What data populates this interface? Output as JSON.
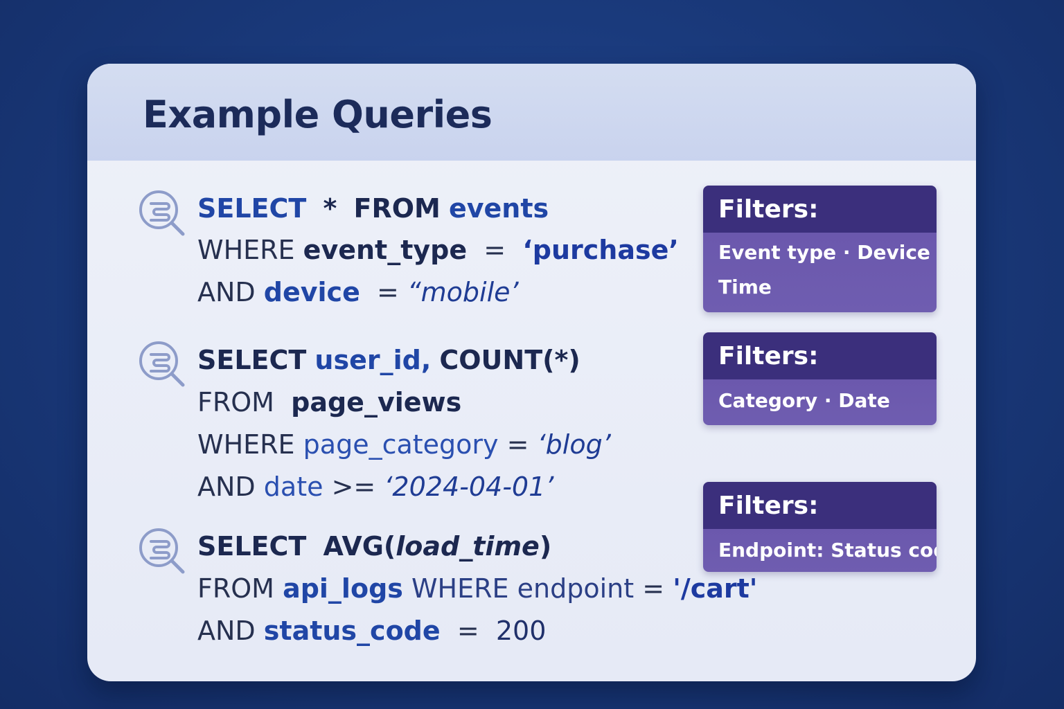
{
  "title": "Example Queries",
  "queries": [
    {
      "icon": "search-database-icon",
      "line1": {
        "a": "SELECT",
        "b": "*",
        "c": "FROM",
        "d": "events"
      },
      "line2": {
        "a": "WHERE",
        "b": "event_type",
        "c": "=",
        "d": "‘purchase’"
      },
      "line3": {
        "a": "AND",
        "b": "device",
        "c": "=",
        "d": "“mobile’"
      }
    },
    {
      "icon": "search-database-icon",
      "line1": {
        "a": "SELECT",
        "b": "user_id,",
        "c": "COUNT(*)"
      },
      "line2": {
        "a": "FROM",
        "b": "page_views"
      },
      "line3": {
        "a": "WHERE",
        "b": "page_category",
        "c": "=",
        "d": "‘blog’"
      },
      "line4": {
        "a": "AND",
        "b": "date",
        "c": ">=",
        "d": "‘2024-04-01’"
      }
    },
    {
      "icon": "search-database-icon",
      "line1": {
        "a": "SELECT",
        "b": "AVG(",
        "c": "load_time",
        "d": ")"
      },
      "line2": {
        "a": "FROM",
        "b": "api_logs",
        "c": "WHERE",
        "d": "endpoint",
        "e": "=",
        "f": "'/cart'"
      },
      "line3": {
        "a": "AND",
        "b": "status_code",
        "c": "=",
        "d": "200"
      }
    }
  ],
  "filters": [
    {
      "heading": "Filters:",
      "rows": [
        "Event type · Device",
        "Time"
      ]
    },
    {
      "heading": "Filters:",
      "rows": [
        "Category · Date"
      ]
    },
    {
      "heading": "Filters:",
      "rows": [
        "Endpoint: Status code"
      ]
    }
  ],
  "colors": {
    "background": "#1a3a7c",
    "header": "#c9d3ee",
    "filter_head": "#3b2f7c",
    "filter_body": "#6b58ad",
    "keyword_blue": "#2046a6"
  }
}
